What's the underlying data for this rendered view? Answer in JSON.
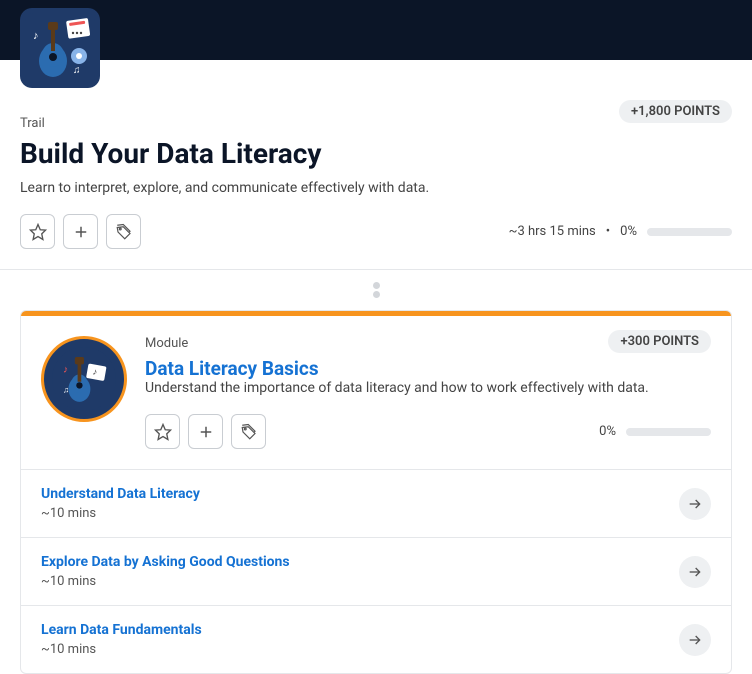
{
  "trail": {
    "type_label": "Trail",
    "title": "Build Your Data Literacy",
    "description": "Learn to interpret, explore, and communicate effectively with data.",
    "points_label": "+1,800 POINTS",
    "duration_label": "~3 hrs 15 mins",
    "separator": "•",
    "progress_pct": "0%"
  },
  "module": {
    "type_label": "Module",
    "title": "Data Literacy Basics",
    "description": "Understand the importance of data literacy and how to work effectively with data.",
    "points_label": "+300 POINTS",
    "progress_pct": "0%"
  },
  "units": [
    {
      "title": "Understand Data Literacy",
      "duration": "~10 mins"
    },
    {
      "title": "Explore Data by Asking Good Questions",
      "duration": "~10 mins"
    },
    {
      "title": "Learn Data Fundamentals",
      "duration": "~10 mins"
    }
  ]
}
